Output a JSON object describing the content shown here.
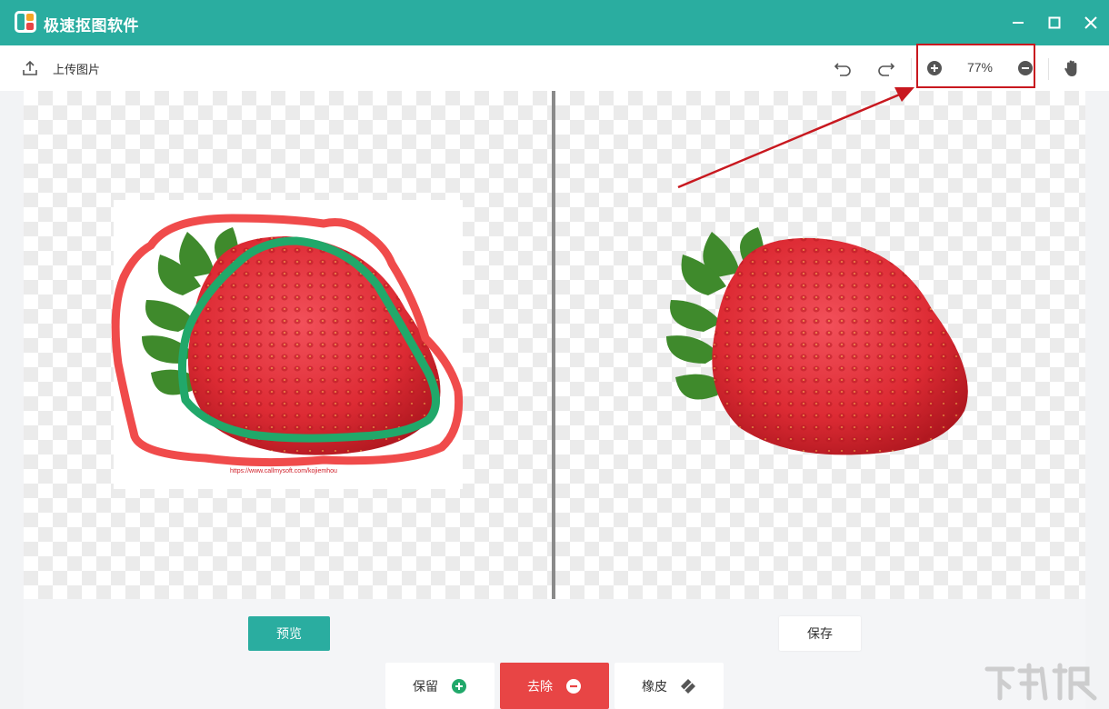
{
  "app": {
    "title": "极速抠图软件"
  },
  "toolbar": {
    "upload_label": "上传图片",
    "zoom": "77%"
  },
  "actions": {
    "preview_label": "预览",
    "save_label": "保存"
  },
  "brush_tools": [
    {
      "label": "保留",
      "icon": "plus-circle-icon"
    },
    {
      "label": "去除",
      "icon": "minus-circle-icon"
    },
    {
      "label": "橡皮",
      "icon": "eraser-icon"
    }
  ],
  "source_image": {
    "caption_url": "https://www.callmysoft.com/kojiemhou"
  },
  "colors": {
    "title_bar": "#2aada0",
    "primary": "#2aada0",
    "remove_active": "#e84545",
    "keep_stroke": "#21a86a",
    "remove_stroke": "#f04b4b",
    "highlight": "#c8181f"
  }
}
